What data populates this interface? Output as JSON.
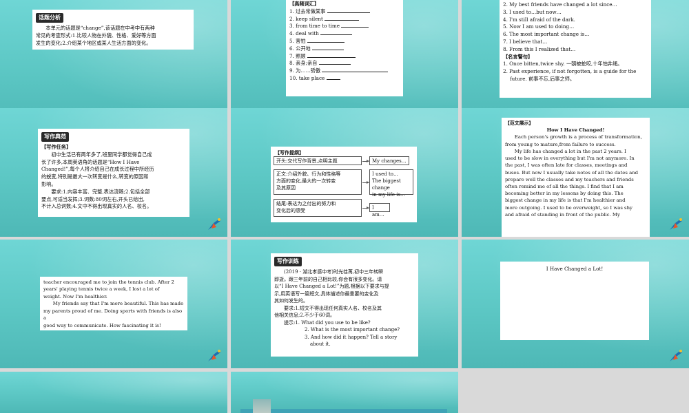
{
  "slides": {
    "s1": {
      "tag": "话题分析",
      "lines": [
        "本单元的话题是“change”,该话题在中考中有两种",
        "常见的考查形式:1.比较人物在外貌、性格、爱好等方面",
        "发生的变化;2.介绍某个地区或某人生活方面的变化。"
      ]
    },
    "s2": {
      "header": "【高频词汇】",
      "items": [
        "1. 过去常做某事",
        "2. keep silent",
        "3. from time to time",
        "4. deal with",
        "5. 害怕",
        "6. 公开地",
        "7. 照顾",
        "8. 亲身;亲自",
        "9. 为……骄傲",
        "10. take place"
      ]
    },
    "s3": {
      "items_top": [
        "2. My best friends have changed a lot since…",
        "3. I used to…but now…",
        "4. I'm still afraid of the dark.",
        "5. Now I am used to doing…",
        "6. The most important change is…",
        "7. I believe that…",
        "8. From this I realized that…"
      ],
      "header2": "【名言警句】",
      "quote1": "1. Once bitten,twice shy. 一朝被蛇咬,十年怕井绳。",
      "quote2a": "2. Past experience, if not forgotten, is a guide for the",
      "quote2b": "future. 前事不忘,后事之师。"
    },
    "s4": {
      "tag": "写作典范",
      "header": "【写作任务】",
      "task": [
        "初中生活已有两年多了,班里同学都觉得自己成",
        "长了许多,本周英语角的话题是“How I Have",
        "Changed!”,每个人将介绍自己在成长过程中所经历",
        "的蜕变,特别是最大一次转变是什么,转变的原因和",
        "影响。"
      ],
      "req": [
        "要求:1.内容丰富、完整,表达流畅;2.包括全部",
        "要点,可适当发挥;3.词数:80词左右,开头已给出,",
        "不计入总词数;4.文中不得出现真实的人名、校名。"
      ]
    },
    "s5": {
      "header": "【写作提纲】",
      "b1": "开头:交代写作背景,点明主题",
      "b1r": "My changes…",
      "b2a": "正文:介绍外貌、行为和性格等",
      "b2b": "方面的变化,最大的一次转变",
      "b2c": "及其原因",
      "b2r1": "I used to…",
      "b2r2": "The biggest change",
      "b2r3": "in my life is…",
      "b3a": "结尾:表达为之付出的努力和",
      "b3b": "变化后的感受",
      "b3r": "I am…"
    },
    "s6": {
      "header": "【范文展示】",
      "title": "How I Have Changed!",
      "lines": [
        "Each person's growth is a process of transformation,",
        "from young to mature,from failure to success.",
        "My life has changed a lot in the past 2 years. I",
        "used to be slow in everything but I'm not anymore. In",
        "the past, I was often late for classes, meetings and",
        "buses. But now I usually take notes of all the dates and",
        "prepare well the classes and my teachers and friends",
        "often remind me of all the things. I find that I am",
        "becoming better in my lessons by doing this. The",
        "biggest change in my life is that I'm healthier and",
        "more outgoing. I used to be overweight, so I was shy",
        "and afraid of standing in front of the public. My"
      ]
    },
    "s7": {
      "lines": [
        "teacher encouraged me to join the tennis club. After 2",
        "years' playing tennis twice a week, I lost a lot of",
        "weight. Now I'm healthier.",
        "My friends say that I'm more beautiful. This has made",
        "my parents proud of me. Doing sports with friends is also a",
        "good way to communicate. How fascinating it is!"
      ]
    },
    "s8": {
      "tag": "写作训练",
      "lines": [
        "(2019 · 湖北孝感中考)时光荏苒,初中三年转瞬",
        "即逝。跟三年前的自己相比较,你会有很多变化。请",
        "以“I Have Changed a Lot!”为题,根据以下要求与提",
        "示,用英语写一篇短文,具体描述你最重要的变化及",
        "其如何发生的。",
        "要求:1.短文不得出现任何真实人名、校名及其",
        "他相关信息;2.不少于60词。",
        "提示:1. What did you use to be like?",
        "2. What is the most important change?",
        "3. And how did it happen? Tell a story",
        "about it."
      ]
    },
    "s9": {
      "title": "I Have Changed a Lot!"
    }
  },
  "colors": {
    "slide_bg": "#5cc7c4",
    "canvas_bg": "#d9d9d9"
  }
}
